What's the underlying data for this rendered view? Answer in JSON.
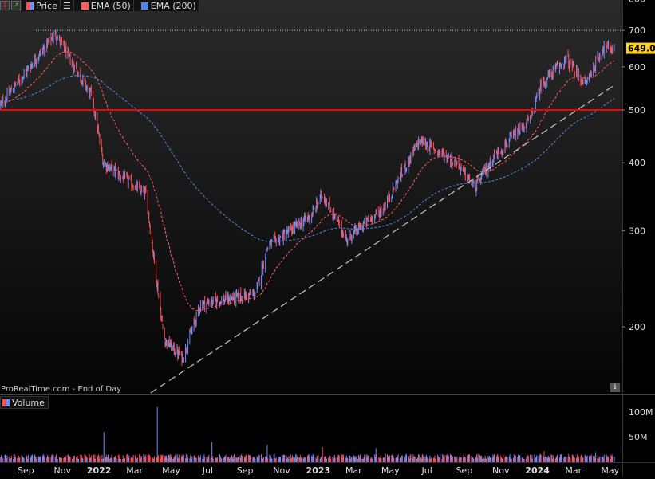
{
  "branding": "ProRealTime.com - End of Day",
  "legend": {
    "price": "Price",
    "ema50": "EMA (50)",
    "ema200": "EMA (200)"
  },
  "volume_label": "Volume",
  "info_icon": "i",
  "colors": {
    "up": "#6f8fff",
    "down": "#ff4f4f",
    "ema50": "#ff5c5c",
    "ema200": "#4f86e8",
    "support": "#ff0000",
    "trend": "#bbbbbb",
    "last_price_bg": "#ffd21a"
  },
  "chart_data": {
    "type": "candlestick",
    "scale": "log",
    "last_price": "649.00",
    "y_ticks": [
      200,
      300,
      400,
      500,
      600,
      700,
      800
    ],
    "x_ticks": [
      "Sep",
      "Nov",
      "2022",
      "Mar",
      "May",
      "Jul",
      "Sep",
      "Nov",
      "2023",
      "Mar",
      "May",
      "Jul",
      "Sep",
      "Nov",
      "2024",
      "Mar",
      "May"
    ],
    "support_level": 500,
    "resistance_level": 700,
    "volume_ticks": [
      "100M",
      "50M"
    ],
    "key_points": [
      {
        "date": "2021-08",
        "close": 510
      },
      {
        "date": "2021-11",
        "close": 690
      },
      {
        "date": "2022-01",
        "close": 530
      },
      {
        "date": "2022-01-20",
        "close": 400
      },
      {
        "date": "2022-04",
        "close": 350
      },
      {
        "date": "2022-05",
        "close": 190
      },
      {
        "date": "2022-06",
        "close": 175
      },
      {
        "date": "2022-07",
        "close": 220
      },
      {
        "date": "2022-10",
        "close": 230
      },
      {
        "date": "2022-10-20",
        "close": 280
      },
      {
        "date": "2023-01",
        "close": 320
      },
      {
        "date": "2023-01-20",
        "close": 350
      },
      {
        "date": "2023-03",
        "close": 290
      },
      {
        "date": "2023-05",
        "close": 330
      },
      {
        "date": "2023-07",
        "close": 440
      },
      {
        "date": "2023-09",
        "close": 400
      },
      {
        "date": "2023-10",
        "close": 360
      },
      {
        "date": "2023-11",
        "close": 410
      },
      {
        "date": "2024-01",
        "close": 480
      },
      {
        "date": "2024-01-20",
        "close": 560
      },
      {
        "date": "2024-03",
        "close": 620
      },
      {
        "date": "2024-04",
        "close": 555
      },
      {
        "date": "2024-05",
        "close": 649
      }
    ]
  }
}
